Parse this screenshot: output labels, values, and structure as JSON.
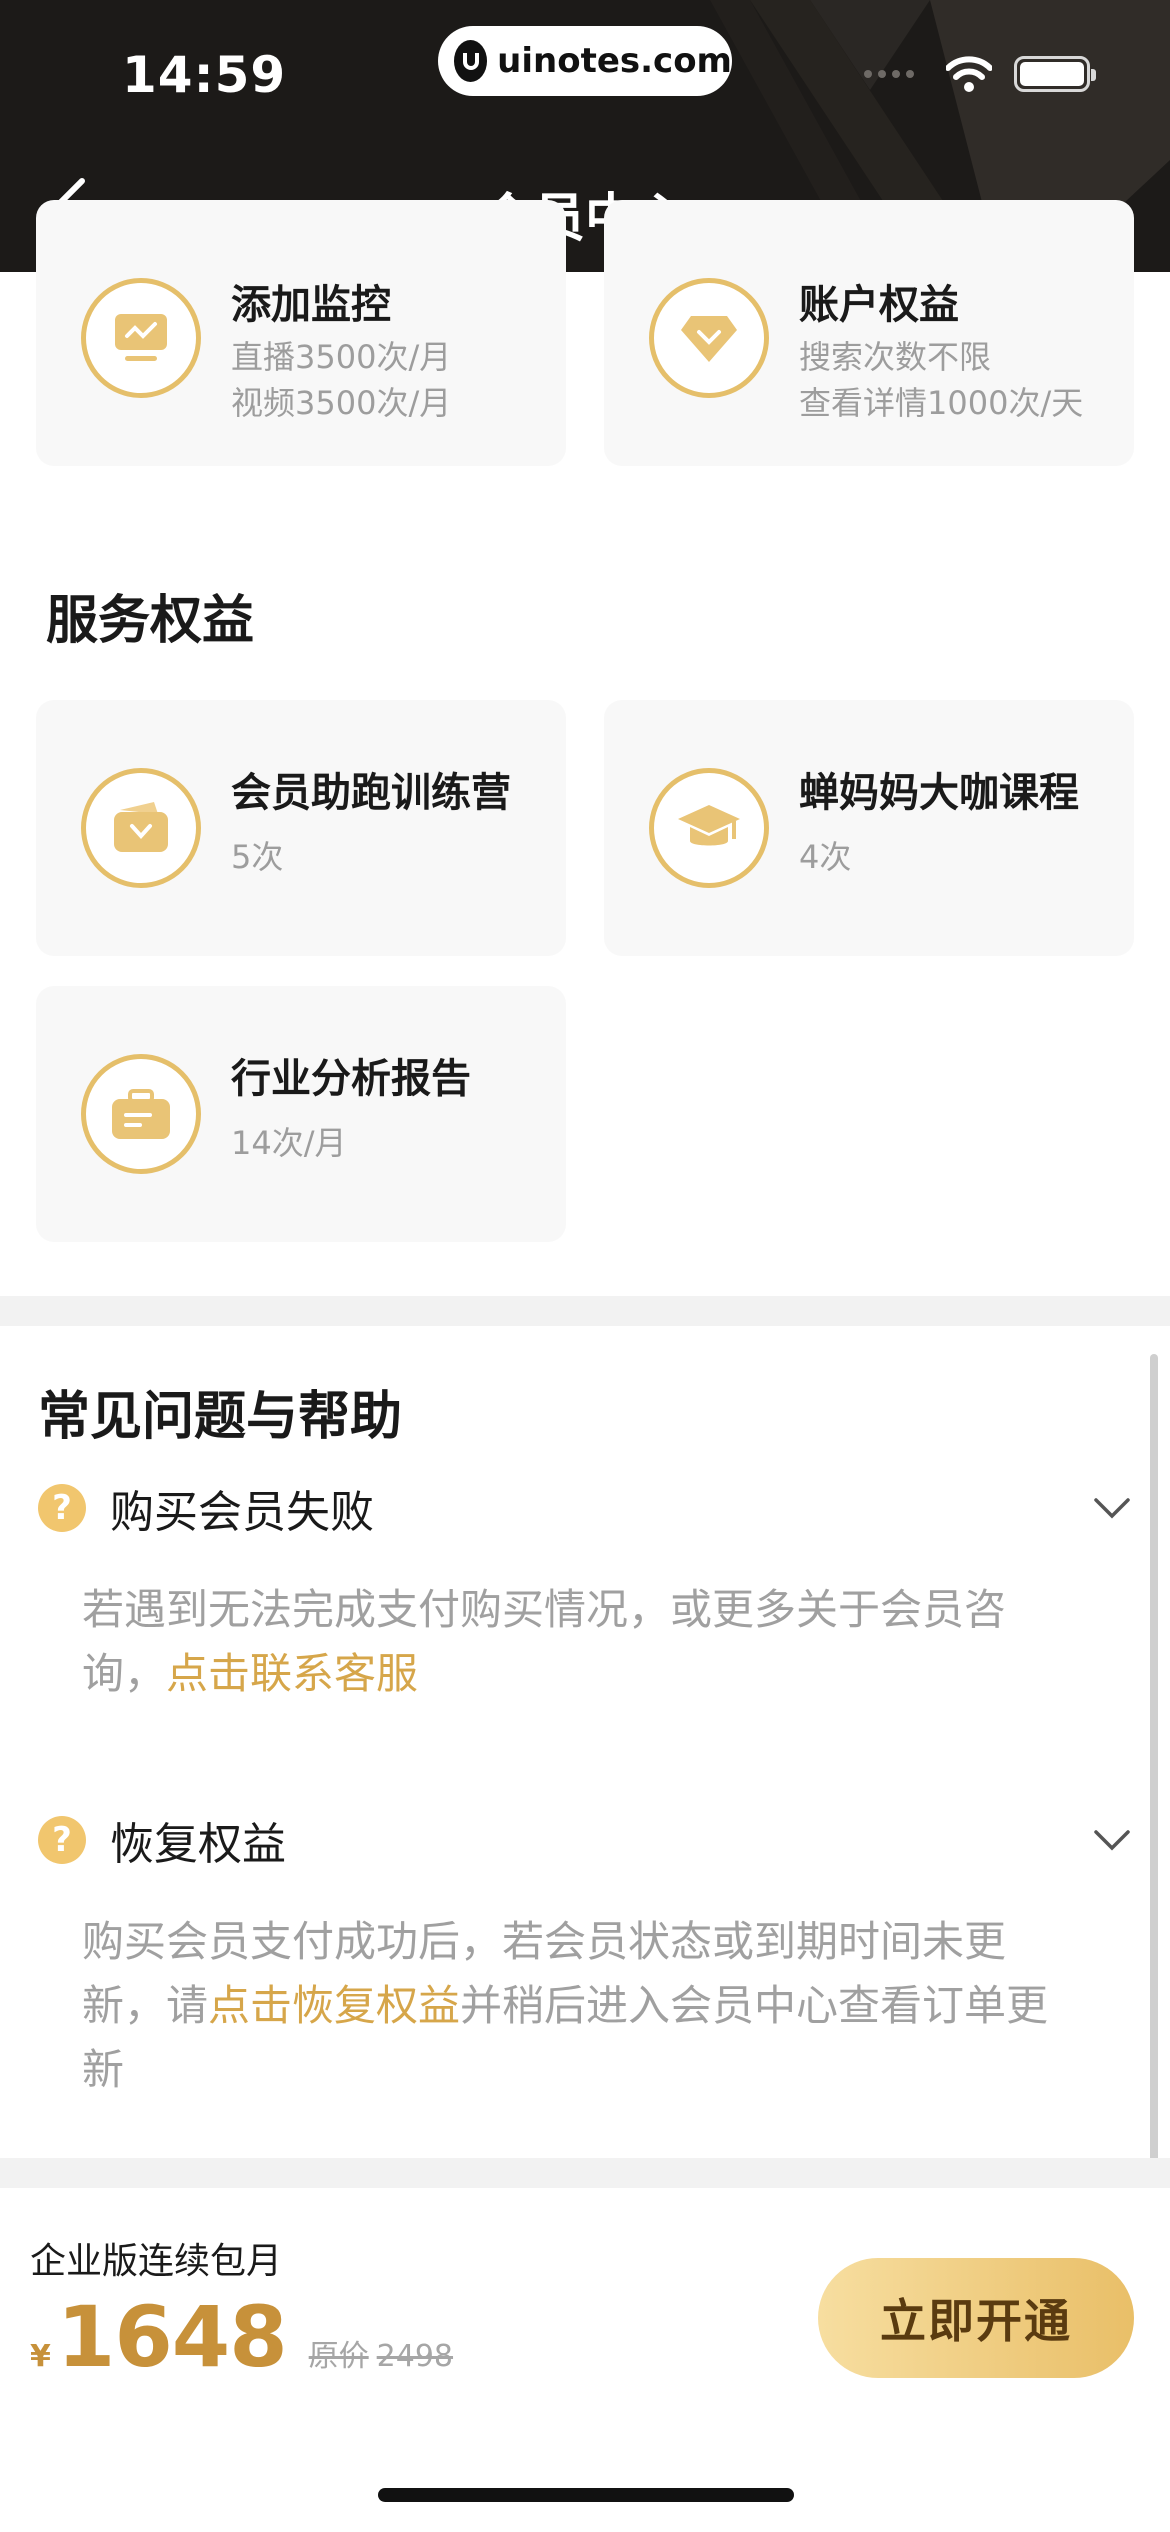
{
  "status_bar": {
    "time": "14:59",
    "url": "uinotes.com"
  },
  "header": {
    "title": "会员中心"
  },
  "top_cards": [
    {
      "title": "添加监控",
      "lines": [
        "直播3500次/月",
        "视频3500次/月"
      ]
    },
    {
      "title": "账户权益",
      "lines": [
        "搜索次数不限",
        "查看详情1000次/天"
      ]
    }
  ],
  "services": {
    "title": "服务权益",
    "items": [
      {
        "title": "会员助跑训练营",
        "sub": "5次"
      },
      {
        "title": "蝉妈妈大咖课程",
        "sub": "4次"
      },
      {
        "title": "行业分析报告",
        "sub": "14次/月"
      }
    ]
  },
  "faq": {
    "title": "常见问题与帮助",
    "items": [
      {
        "question": "购买会员失败",
        "answer_pre": "若遇到无法完成支付购买情况，或更多关于会员咨询，",
        "answer_link": "点击联系客服",
        "answer_post": ""
      },
      {
        "question": "恢复权益",
        "answer_pre": "购买会员支付成功后，若会员状态或到期时间未更新，请",
        "answer_link": "点击恢复权益",
        "answer_post": "并稍后进入会员中心查看订单更新"
      }
    ]
  },
  "purchase": {
    "plan_name": "企业版连续包月",
    "currency": "¥",
    "price": "1648",
    "original_label": "原价",
    "original_price": "2498",
    "cta_label": "立即开通"
  },
  "colors": {
    "accent": "#e5bf6a",
    "price": "#c7913a",
    "link": "#d6a64a",
    "header_bg": "#1c1a18"
  }
}
